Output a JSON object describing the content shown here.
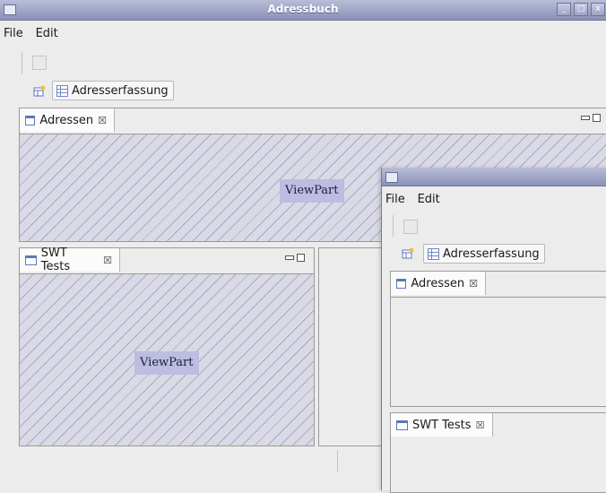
{
  "window": {
    "title": "Adressbuch",
    "controls": [
      "minimize",
      "maximize",
      "close"
    ]
  },
  "menu": {
    "items": [
      "File",
      "Edit"
    ]
  },
  "perspective_bar": {
    "button_label": "Adresserfassung"
  },
  "views": {
    "top": {
      "tab_label": "Adressen",
      "placeholder": "ViewPart"
    },
    "bottom_left": {
      "tab_label": "SWT Tests",
      "placeholder": "ViewPart"
    }
  },
  "second_window": {
    "menu": {
      "items": [
        "File",
        "Edit"
      ]
    },
    "perspective_bar": {
      "button_label": "Adresserfassung"
    },
    "views": {
      "top": {
        "tab_label": "Adressen"
      },
      "bottom": {
        "tab_label": "SWT Tests"
      }
    }
  },
  "colors": {
    "titlebar": "#8a90b8",
    "hatch_background": "#dadae6",
    "viewpart_label_bg": "#bcbde0",
    "window_bg": "#ececec"
  }
}
